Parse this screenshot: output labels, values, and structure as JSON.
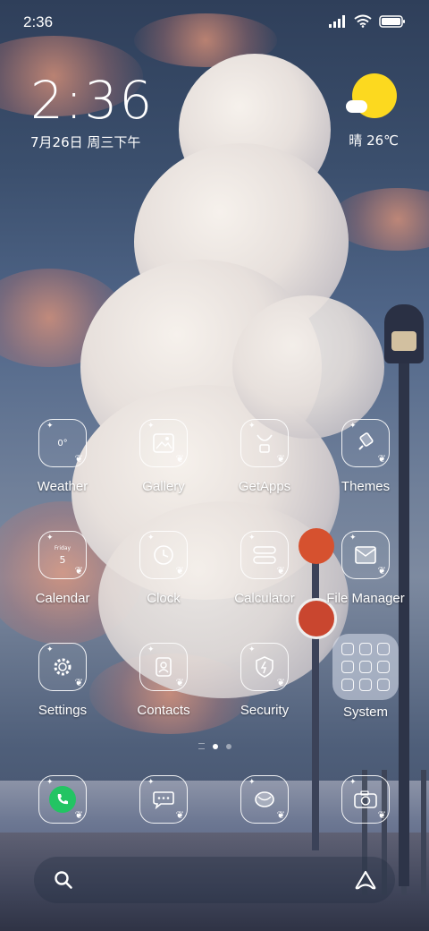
{
  "status_bar": {
    "time": "2:36"
  },
  "clock_widget": {
    "time": "2:36",
    "date": "7月26日 周三下午"
  },
  "weather_widget": {
    "text": "晴 26℃"
  },
  "apps": [
    {
      "label": "Weather",
      "icon": "weather-icon",
      "glyph": "0°"
    },
    {
      "label": "Gallery",
      "icon": "gallery-icon"
    },
    {
      "label": "GetApps",
      "icon": "getapps-icon"
    },
    {
      "label": "Themes",
      "icon": "themes-icon"
    },
    {
      "label": "Calendar",
      "icon": "calendar-icon",
      "day": "Friday",
      "date": "5"
    },
    {
      "label": "Clock",
      "icon": "clock-icon"
    },
    {
      "label": "Calculator",
      "icon": "calculator-icon"
    },
    {
      "label": "File Manager",
      "icon": "file-manager-icon"
    },
    {
      "label": "Settings",
      "icon": "settings-icon"
    },
    {
      "label": "Contacts",
      "icon": "contacts-icon"
    },
    {
      "label": "Security",
      "icon": "security-icon"
    },
    {
      "label": "System",
      "icon": "folder-icon"
    }
  ],
  "page_indicator": {
    "pages": 2,
    "current": 1
  },
  "dock": [
    {
      "icon": "phone-icon"
    },
    {
      "icon": "messages-icon"
    },
    {
      "icon": "browser-icon"
    },
    {
      "icon": "camera-icon"
    }
  ],
  "colors": {
    "sun": "#fcd91f",
    "phone_green": "#23c463",
    "icon_stroke": "#ffffff"
  }
}
